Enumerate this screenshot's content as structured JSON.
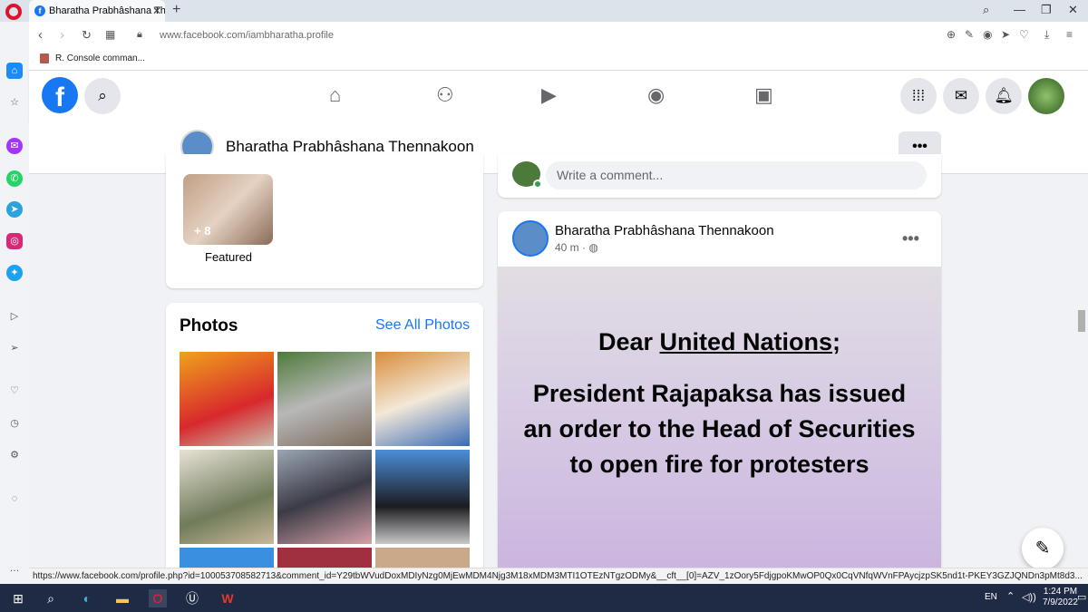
{
  "browser": {
    "tab_title": "Bharatha Prabhâshana Then",
    "tab_close": "✕",
    "new_tab": "+",
    "url_host": "www.facebook.com",
    "url_path": "/iambharatha.profile",
    "bookmark_label": "R. Console comman..."
  },
  "facebook": {
    "logo": "f",
    "profile_name": "Bharatha Prabhâshana Thennakoon",
    "more_label": "•••",
    "featured": {
      "count": "+ 8",
      "label": "Featured"
    },
    "photos": {
      "title": "Photos",
      "see_all": "See All Photos"
    },
    "comment_placeholder": "Write a comment...",
    "post": {
      "author": "Bharatha Prabhâshana Thennakoon",
      "time": "40 m",
      "separator": "·",
      "more_label": "•••",
      "line1_prefix": "Dear ",
      "line1_link": "United Nations",
      "line1_suffix": ";",
      "body": "President Rajapaksa has issued an order to the Head of Securities to open fire for protesters"
    }
  },
  "status_url": "https://www.facebook.com/profile.php?id=100053708582713&comment_id=Y29tbWVudDoxMDIyNzg0MjEwMDM4Njg3M18xMDM3MTI1OTEzNTgzODMy&__cft__[0]=AZV_1zOory5FdjgpoKMwOP0Qx0CqVNfqWVnFPAycjzpSK5nd1t-PKEY3GZJQNDn3pMt8d3...",
  "taskbar": {
    "lang": "EN",
    "time": "1:24 PM",
    "date": "7/9/2022"
  },
  "colors": {
    "facebook_blue": "#1877f2",
    "taskbar": "#1f2a44",
    "opera_red": "#e0112b"
  }
}
